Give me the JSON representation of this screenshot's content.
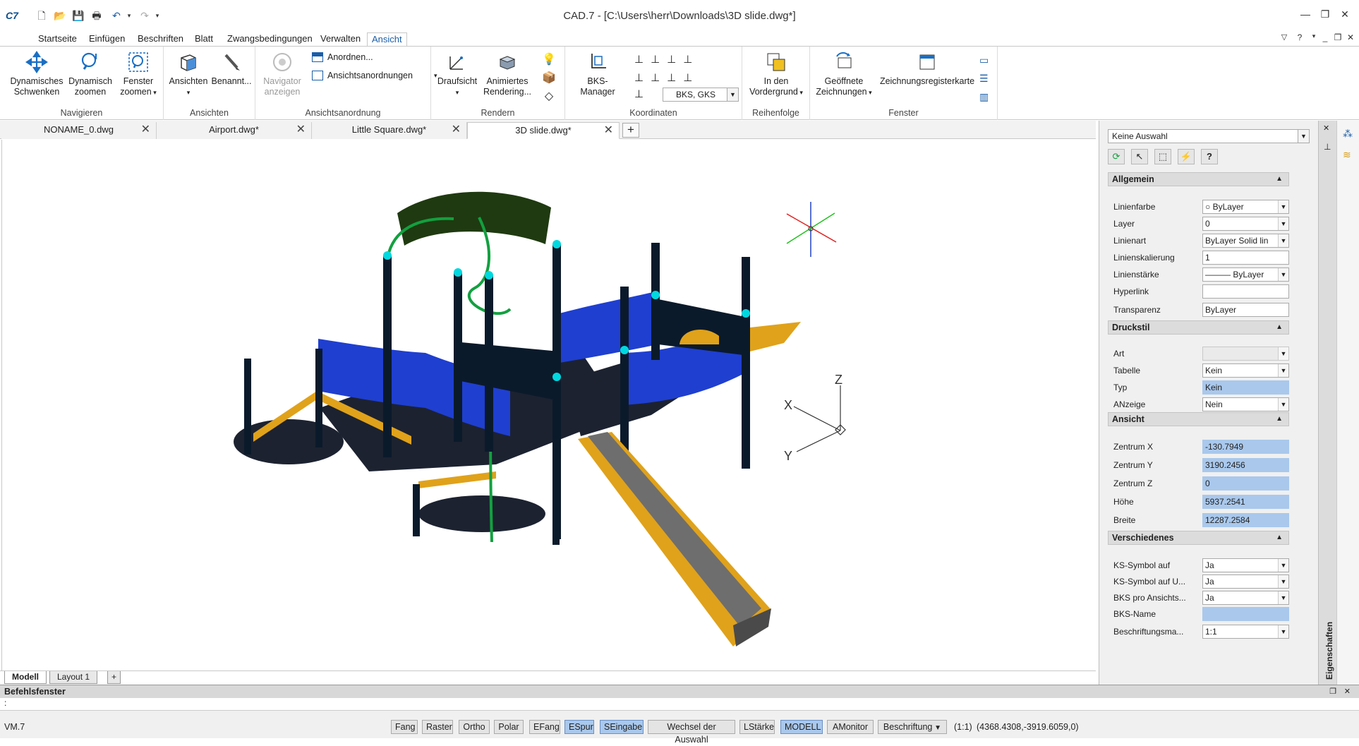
{
  "app": {
    "title": "CAD.7 - [C:\\Users\\herr\\Downloads\\3D slide.dwg*]",
    "logo": "C7"
  },
  "ribbon_tabs": [
    "Startseite",
    "Einfügen",
    "Beschriften",
    "Blatt",
    "Zwangsbedingungen",
    "Verwalten",
    "Ansicht"
  ],
  "active_ribbon_tab": "Ansicht",
  "ribbon": {
    "navigieren": {
      "label": "Navigieren",
      "pan": "Dynamisches\nSchwenken",
      "zoom": "Dynamisch\nzoomen",
      "window_zoom": "Fenster\nzoomen"
    },
    "ansichten": {
      "label": "Ansichten",
      "views": "Ansichten",
      "named": "Benannt..."
    },
    "ansichtsanordnung": {
      "label": "Ansichtsanordnung",
      "navigator": "Navigator\nanzeigen",
      "arrange": "Anordnen...",
      "view_arrangements": "Ansichtsanordnungen"
    },
    "rendern": {
      "label": "Rendern",
      "top_view": "Draufsicht",
      "animated_render": "Animiertes\nRendering..."
    },
    "koordinaten": {
      "label": "Koordinaten",
      "ucs_manager": "BKS-Manager",
      "ucs_select": "BKS, GKS"
    },
    "reihenfolge": {
      "label": "Reihenfolge",
      "foreground": "In den\nVordergrund"
    },
    "fenster": {
      "label": "Fenster",
      "open_drawings": "Geöffnete\nZeichnungen",
      "drawing_tab": "Zeichnungsregisterkarte"
    }
  },
  "doc_tabs": [
    {
      "label": "NONAME_0.dwg",
      "active": false
    },
    {
      "label": "Airport.dwg*",
      "active": false
    },
    {
      "label": "Little Square.dwg*",
      "active": false
    },
    {
      "label": "3D slide.dwg*",
      "active": true
    }
  ],
  "layout_tabs": [
    "Modell",
    "Layout 1"
  ],
  "viewport": {
    "ucs_labels": {
      "x": "X",
      "y": "Y",
      "z": "Z"
    }
  },
  "properties": {
    "selection": "Keine Auswahl",
    "side_label": "Eigenschaften",
    "sections": [
      {
        "title": "Allgemein",
        "rows": [
          {
            "label": "Linienfarbe",
            "value": "ByLayer",
            "type": "dd"
          },
          {
            "label": "Layer",
            "value": "0",
            "type": "dd"
          },
          {
            "label": "Linienart",
            "value": "ByLayer      Solid lin",
            "type": "dd"
          },
          {
            "label": "Linienskalierung",
            "value": "1",
            "type": "text"
          },
          {
            "label": "Linienstärke",
            "value": "——— ByLayer",
            "type": "dd"
          },
          {
            "label": "Hyperlink",
            "value": "",
            "type": "text"
          },
          {
            "label": "Transparenz",
            "value": "ByLayer",
            "type": "text"
          }
        ]
      },
      {
        "title": "Druckstil",
        "rows": [
          {
            "label": "Art",
            "value": "",
            "type": "grey"
          },
          {
            "label": "Tabelle",
            "value": "Kein",
            "type": "dd"
          },
          {
            "label": "Typ",
            "value": "Kein",
            "type": "ro"
          },
          {
            "label": "ANzeige",
            "value": "Nein",
            "type": "dd"
          }
        ]
      },
      {
        "title": "Ansicht",
        "rows": [
          {
            "label": "Zentrum X",
            "value": "-130.7949",
            "type": "ro"
          },
          {
            "label": "Zentrum Y",
            "value": "3190.2456",
            "type": "ro"
          },
          {
            "label": "Zentrum Z",
            "value": "0",
            "type": "ro"
          },
          {
            "label": "Höhe",
            "value": "5937.2541",
            "type": "ro"
          },
          {
            "label": "Breite",
            "value": "12287.2584",
            "type": "ro"
          }
        ]
      },
      {
        "title": "Verschiedenes",
        "rows": [
          {
            "label": "KS-Symbol auf",
            "value": "Ja",
            "type": "dd"
          },
          {
            "label": "KS-Symbol auf U...",
            "value": "Ja",
            "type": "dd"
          },
          {
            "label": "BKS pro Ansichts...",
            "value": "Ja",
            "type": "dd"
          },
          {
            "label": "BKS-Name",
            "value": "",
            "type": "ro"
          },
          {
            "label": "Beschriftungsma...",
            "value": "1:1",
            "type": "dd"
          }
        ]
      }
    ]
  },
  "command_window": {
    "title": "Befehlsfenster",
    "prompt": ":"
  },
  "status": {
    "version": "VM.7",
    "buttons": [
      {
        "label": "Fang",
        "on": false
      },
      {
        "label": "Raster",
        "on": false
      },
      {
        "label": "Ortho",
        "on": false
      },
      {
        "label": "Polar",
        "on": false
      },
      {
        "label": "EFang",
        "on": false
      },
      {
        "label": "ESpur",
        "on": true
      },
      {
        "label": "SEingabe",
        "on": true
      },
      {
        "label": "Wechsel der Auswahl",
        "on": false
      },
      {
        "label": "LStärke",
        "on": false
      },
      {
        "label": "MODELL",
        "on": true
      },
      {
        "label": "AMonitor",
        "on": false
      },
      {
        "label": "Beschriftung",
        "on": false
      }
    ],
    "scale": "(1:1)",
    "coords": "(4368.4308,-3919.6059,0)"
  },
  "colors": {
    "accent": "#1a5ea8",
    "selected": "#a9c8ec",
    "blue_panel": "#1f3fd0",
    "yellow": "#e0a21a",
    "post": "#0b1a2b",
    "deck": "#1c2230",
    "green": "#13a040",
    "roof": "#1f3a10"
  }
}
